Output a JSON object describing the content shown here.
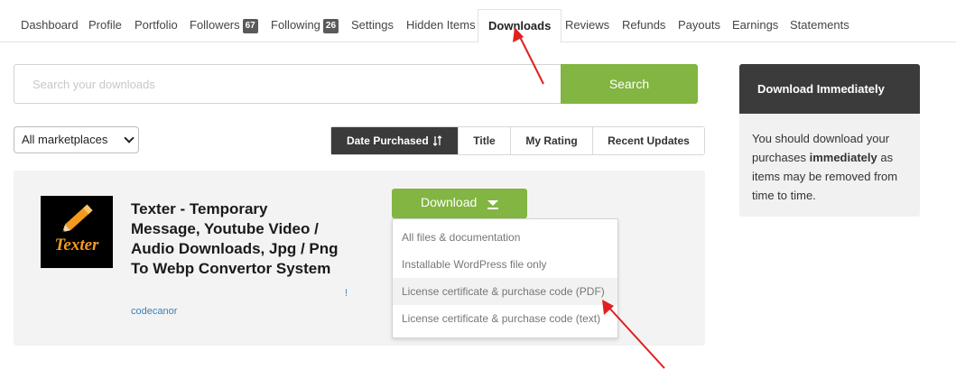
{
  "tabs": {
    "dashboard": "Dashboard",
    "profile": "Profile",
    "portfolio": "Portfolio",
    "followers": "Followers",
    "followers_count": "67",
    "following": "Following",
    "following_count": "26",
    "settings": "Settings",
    "hidden_items": "Hidden Items",
    "downloads": "Downloads",
    "reviews": "Reviews",
    "refunds": "Refunds",
    "payouts": "Payouts",
    "earnings": "Earnings",
    "statements": "Statements"
  },
  "search": {
    "placeholder": "Search your downloads",
    "button_label": "Search"
  },
  "filters": {
    "marketplace_selected": "All marketplaces",
    "sort_options": {
      "date_purchased": "Date Purchased",
      "title": "Title",
      "my_rating": "My Rating",
      "recent_updates": "Recent Updates"
    },
    "active_sort": "date_purchased"
  },
  "item": {
    "thumbnail_text": "Texter",
    "title": "Texter - Temporary Message, Youtube Video / Audio Downloads, Jpg / Png To Webp Convertor System",
    "author": "codecanor",
    "marker": "!",
    "download_label": "Download"
  },
  "download_menu": {
    "all_files": "All files & documentation",
    "wordpress_file": "Installable WordPress file only",
    "license_pdf": "License certificate & purchase code (PDF)",
    "license_text": "License certificate & purchase code (text)"
  },
  "sidebar": {
    "header": "Download Immediately",
    "body_before": "You should download your purchases ",
    "body_emphasis": "immediately",
    "body_after": " as items may be removed from time to time."
  },
  "colors": {
    "accent_green": "#82b541",
    "dark_header": "#3b3b3b",
    "annotation_red": "#e02020",
    "thumbnail_orange": "#f29a1f"
  },
  "icons": {
    "sort": "sort-arrows-icon",
    "caret": "download-caret-icon",
    "thumbnail": "pencil-icon"
  }
}
